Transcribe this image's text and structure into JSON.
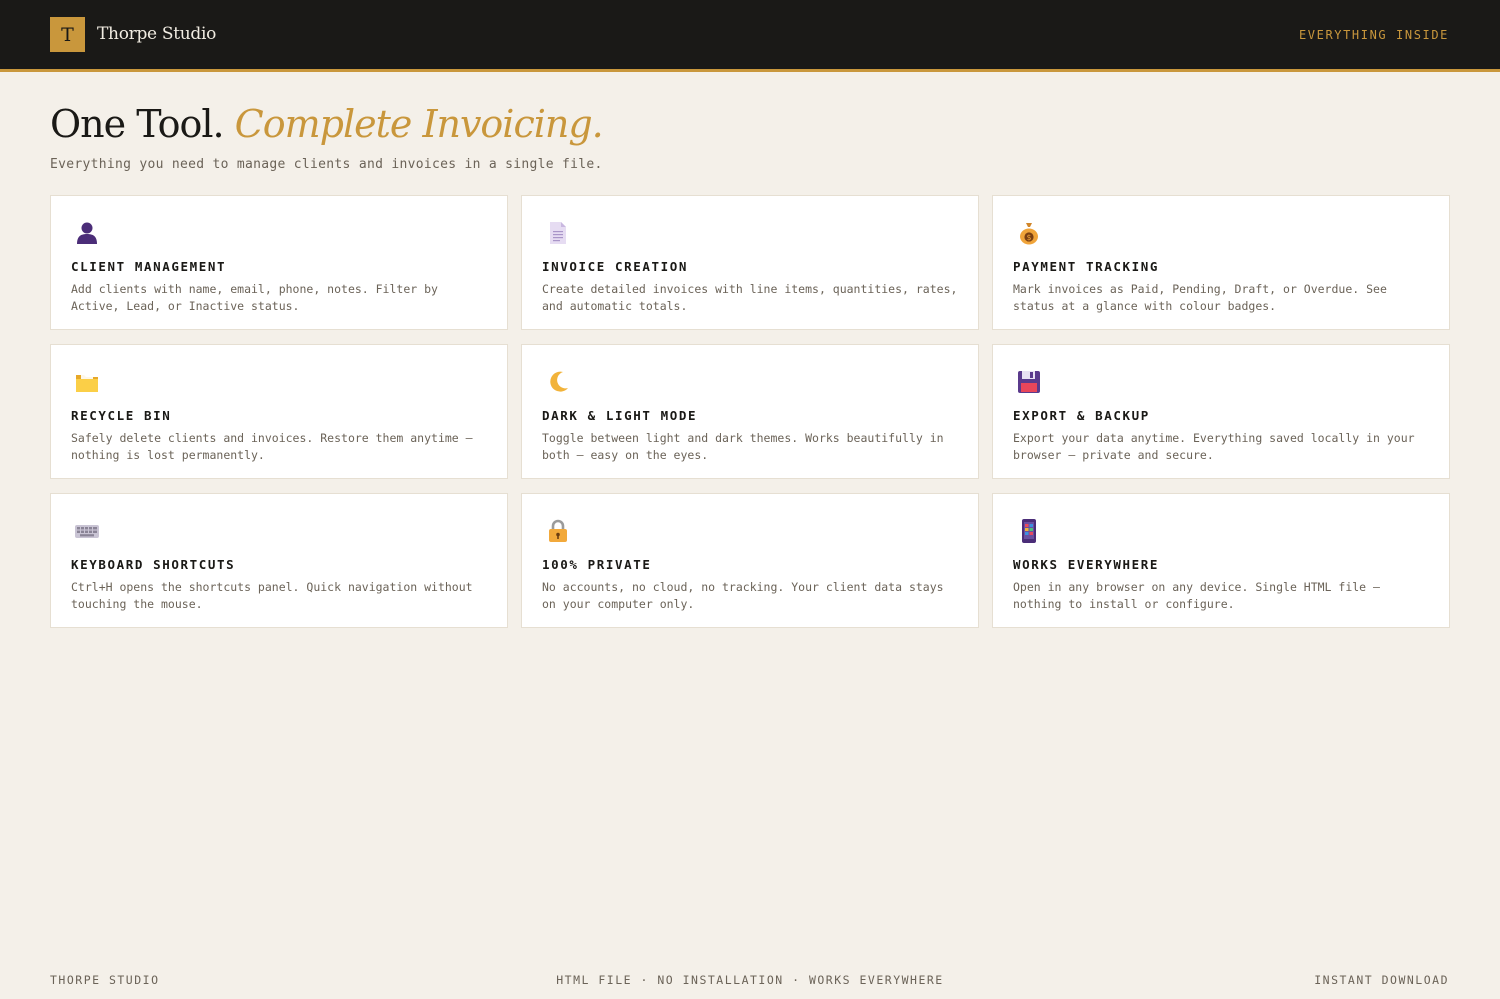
{
  "header": {
    "logo_letter": "T",
    "brand": "Thorpe Studio",
    "nav_link": "EVERYTHING INSIDE"
  },
  "hero": {
    "title_plain": "One Tool.",
    "title_accent": "Complete Invoicing.",
    "subtitle": "Everything you need to manage clients and invoices in a single file."
  },
  "features": [
    {
      "icon": "person-silhouette-icon",
      "title": "CLIENT MANAGEMENT",
      "desc": "Add clients with name, email, phone, notes. Filter by Active, Lead, or Inactive status."
    },
    {
      "icon": "document-icon",
      "title": "INVOICE CREATION",
      "desc": "Create detailed invoices with line items, quantities, rates, and automatic totals."
    },
    {
      "icon": "money-bag-icon",
      "title": "PAYMENT TRACKING",
      "desc": "Mark invoices as Paid, Pending, Draft, or Overdue. See status at a glance with colour badges."
    },
    {
      "icon": "folder-icon",
      "title": "RECYCLE BIN",
      "desc": "Safely delete clients and invoices. Restore them anytime — nothing is lost permanently."
    },
    {
      "icon": "crescent-moon-icon",
      "title": "DARK & LIGHT MODE",
      "desc": "Toggle between light and dark themes. Works beautifully in both — easy on the eyes."
    },
    {
      "icon": "floppy-disk-icon",
      "title": "EXPORT & BACKUP",
      "desc": "Export your data anytime. Everything saved locally in your browser — private and secure."
    },
    {
      "icon": "keyboard-icon",
      "title": "KEYBOARD SHORTCUTS",
      "desc": "Ctrl+H opens the shortcuts panel. Quick navigation without touching the mouse."
    },
    {
      "icon": "lock-icon",
      "title": "100% PRIVATE",
      "desc": "No accounts, no cloud, no tracking. Your client data stays on your computer only."
    },
    {
      "icon": "mobile-device-icon",
      "title": "WORKS EVERYWHERE",
      "desc": "Open in any browser on any device. Single HTML file — nothing to install or configure."
    }
  ],
  "footer": {
    "left": "THORPE STUDIO",
    "center": "HTML FILE · NO INSTALLATION · WORKS EVERYWHERE",
    "right": "INSTANT DOWNLOAD"
  },
  "colors": {
    "accent": "#c9973c",
    "header_bg": "#1a1917",
    "page_bg": "#f4f0e9",
    "card_bg": "#ffffff",
    "muted_text": "#6b6358"
  }
}
